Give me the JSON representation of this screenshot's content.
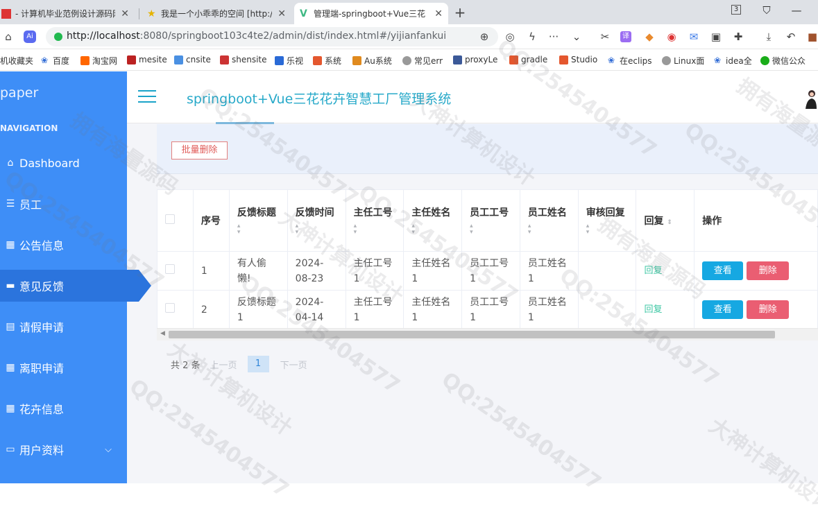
{
  "browser": {
    "tabs": [
      {
        "title": "- 计算机毕业范例设计源码网"
      },
      {
        "title": "我是一个小乖乖的空间 [http://"
      },
      {
        "title": "管理端-springboot+Vue三花"
      }
    ],
    "window_count": "3",
    "url_host": "http://localhost",
    "url_rest": ":8080/springboot103c4te2/admin/dist/index.html#/yijianfankui",
    "bookmarks": [
      "机收藏夹",
      "百度",
      "淘宝网",
      "mesite",
      "cnsite",
      "shensite",
      "乐视",
      "系统",
      "Au系统",
      "常见err",
      "proxyLe",
      "gradle",
      "Studio",
      "在eclips",
      "Linux面",
      "idea全",
      "微信公众"
    ]
  },
  "sidebar": {
    "logo": "paper",
    "nav_label": "NAVIGATION",
    "items": [
      {
        "label": "Dashboard"
      },
      {
        "label": "员工"
      },
      {
        "label": "公告信息"
      },
      {
        "label": "意见反馈"
      },
      {
        "label": "请假申请"
      },
      {
        "label": "离职申请"
      },
      {
        "label": "花卉信息"
      },
      {
        "label": "用户资料"
      }
    ]
  },
  "header": {
    "system_name": "springboot+Vue三花花卉智慧工厂管理系统"
  },
  "actions": {
    "batch_delete": "批量删除"
  },
  "table": {
    "headers": [
      "序号",
      "反馈标题",
      "反馈时间",
      "主任工号",
      "主任姓名",
      "员工工号",
      "员工姓名",
      "审核回复",
      "回复",
      "操作"
    ],
    "rows": [
      {
        "index": "1",
        "title": "有人偷懒!",
        "time": "2024-08-23",
        "director_id": "主任工号1",
        "director_name": "主任姓名1",
        "staff_id": "员工工号1",
        "staff_name": "员工姓名1",
        "review": "",
        "reply": "回复"
      },
      {
        "index": "2",
        "title": "反馈标题1",
        "time": "2024-04-14",
        "director_id": "主任工号1",
        "director_name": "主任姓名1",
        "staff_id": "员工工号1",
        "staff_name": "员工姓名1",
        "review": "",
        "reply": "回复"
      }
    ],
    "view_label": "查看",
    "delete_label": "删除"
  },
  "pager": {
    "total": "共 2 条",
    "prev": "上一页",
    "current": "1",
    "next": "下一页"
  },
  "watermark": [
    "拥有海量源码",
    "大神计算机设计",
    "QQ:2545404577"
  ],
  "colors": {
    "sidebar": "#3e8ef7",
    "sidebar_active": "#2b74dd",
    "title": "#27a9c9",
    "view_button": "#16a8e2",
    "delete_button": "#ea5e72",
    "reply_link": "#3ec7a4"
  }
}
